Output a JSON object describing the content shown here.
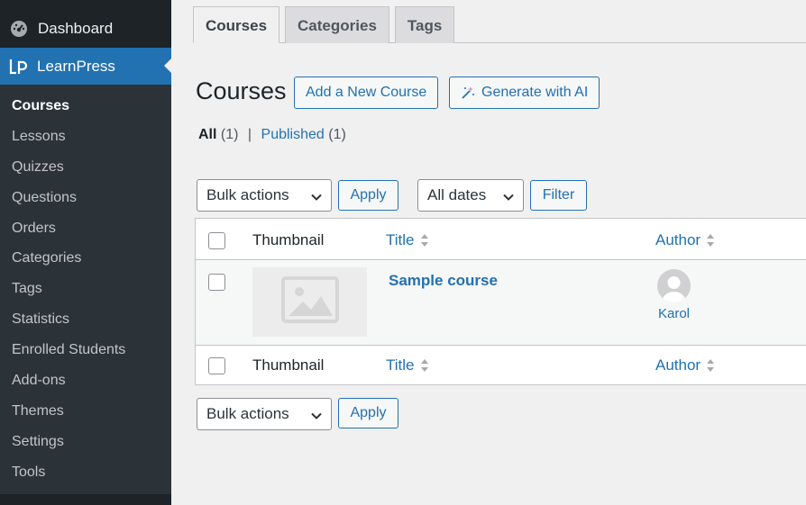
{
  "sidebar": {
    "dashboard_label": "Dashboard",
    "current_label": "LearnPress",
    "items": [
      {
        "label": "Courses",
        "active": true
      },
      {
        "label": "Lessons"
      },
      {
        "label": "Quizzes"
      },
      {
        "label": "Questions"
      },
      {
        "label": "Orders"
      },
      {
        "label": "Categories"
      },
      {
        "label": "Tags"
      },
      {
        "label": "Statistics"
      },
      {
        "label": "Enrolled Students"
      },
      {
        "label": "Add-ons"
      },
      {
        "label": "Themes"
      },
      {
        "label": "Settings"
      },
      {
        "label": "Tools"
      }
    ]
  },
  "tabs": [
    {
      "label": "Courses",
      "active": true
    },
    {
      "label": "Categories"
    },
    {
      "label": "Tags"
    }
  ],
  "header": {
    "title": "Courses",
    "add_new_label": "Add a New Course",
    "generate_label": "Generate with AI"
  },
  "views": {
    "all_label": "All",
    "all_count": "(1)",
    "separator": "|",
    "published_label": "Published",
    "published_count": "(1)"
  },
  "filters": {
    "bulk_actions": "Bulk actions",
    "apply_label": "Apply",
    "dates": "All dates",
    "filter_label": "Filter"
  },
  "table": {
    "columns": {
      "thumbnail": "Thumbnail",
      "title": "Title",
      "author": "Author"
    },
    "rows": [
      {
        "title": "Sample course",
        "author": "Karol"
      }
    ]
  },
  "colors": {
    "accent": "#2271b1",
    "sidebar_bg": "#1d2327",
    "submenu_bg": "#2c3338"
  }
}
